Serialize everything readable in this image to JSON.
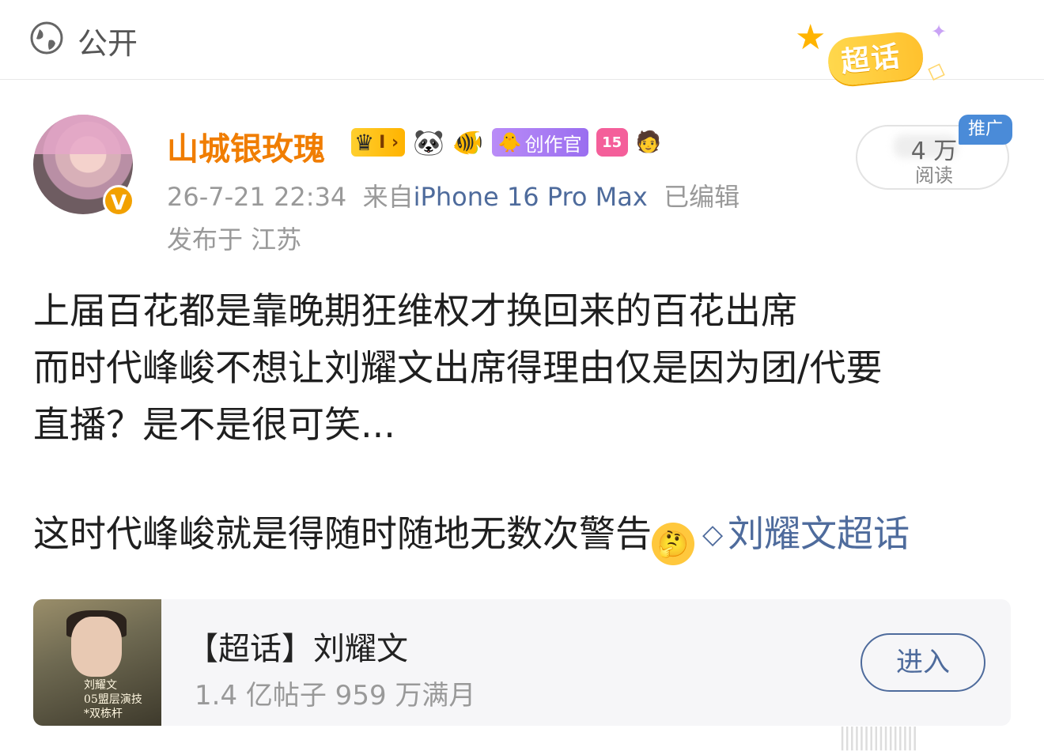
{
  "header": {
    "visibility_label": "公开",
    "supertopic_sticker": "超话",
    "icons": {
      "visibility": "globe-icon"
    }
  },
  "author": {
    "username": "山城银玫瑰",
    "verified_mark": "V",
    "badges": {
      "vip_level": "I",
      "creator": "创作官",
      "level": "15"
    },
    "timestamp": "26-7-21 22:34",
    "source_prefix": "来自",
    "device": "iPhone 16 Pro Max",
    "edited": "已编辑",
    "location": "发布于 江苏"
  },
  "reads": {
    "value": "4  万",
    "label": "阅读",
    "promo_tag": "推广"
  },
  "post": {
    "line1": "上届百花都是靠晚期狂维权才换回来的百花出席",
    "line2": "而时代峰峻不想让刘耀文出席得理由仅是因为团/代要",
    "line3": "直播？是不是很可笑...",
    "line4": "这时代峰峻就是得随时随地无数次警告",
    "topic_link": "刘耀文超话"
  },
  "card": {
    "title": "【超话】刘耀文",
    "stats": "1.4 亿帖子 959 万满月",
    "enter_button": "进入",
    "thumb_text": "刘耀文\n05盟层演技\n双栋杆"
  },
  "colors": {
    "username": "#f07d00",
    "link": "#4e6b9c",
    "meta": "#999999",
    "promo": "#4a8bd8"
  }
}
